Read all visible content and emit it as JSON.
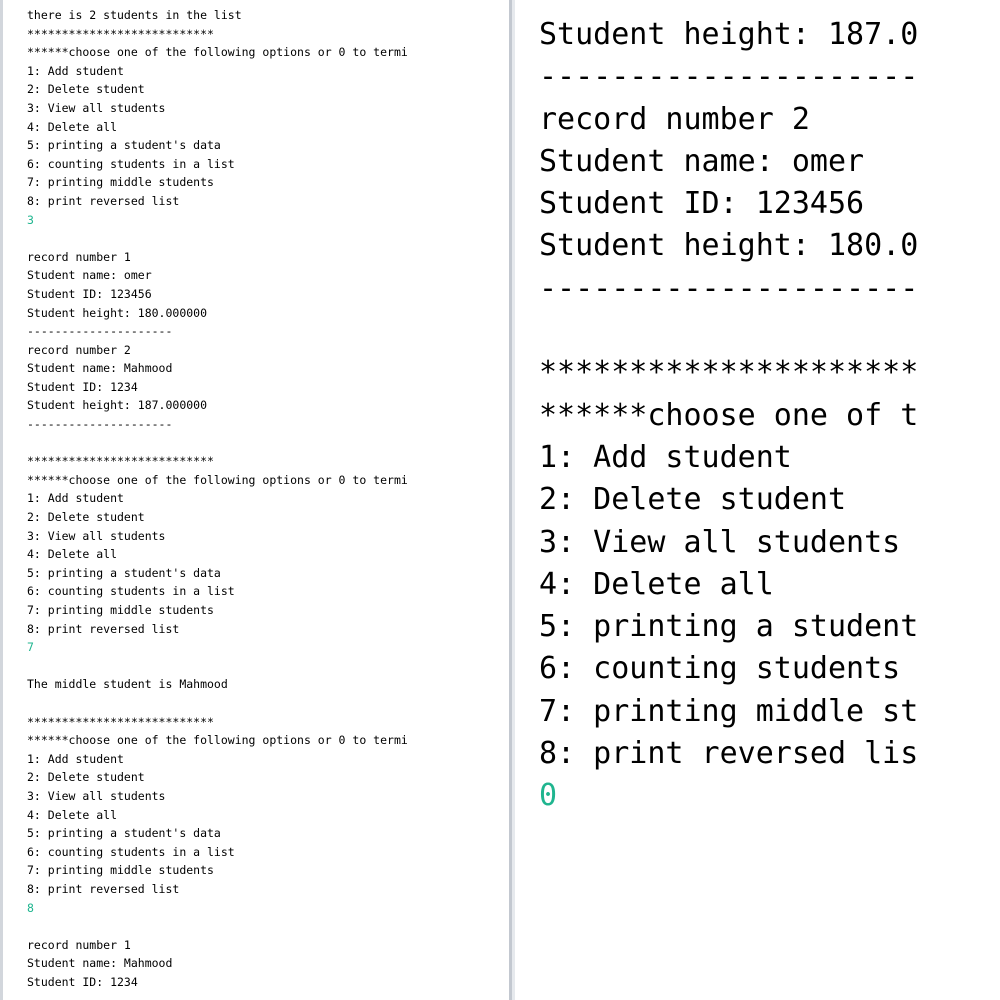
{
  "left_console": {
    "lines": [
      {
        "text": "there is 2 students in the list"
      },
      {
        "text": "***************************"
      },
      {
        "text": "******choose one of the following options or 0 to termi"
      },
      {
        "text": "1: Add student"
      },
      {
        "text": "2: Delete student"
      },
      {
        "text": "3: View all students"
      },
      {
        "text": "4: Delete all"
      },
      {
        "text": "5: printing a student's data"
      },
      {
        "text": "6: counting students in a list"
      },
      {
        "text": "7: printing middle students"
      },
      {
        "text": "8: print reversed list"
      },
      {
        "text": "3",
        "input": true
      },
      {
        "text": ""
      },
      {
        "text": "record number 1"
      },
      {
        "text": "Student name: omer"
      },
      {
        "text": "Student ID: 123456"
      },
      {
        "text": "Student height: 180.000000"
      },
      {
        "text": "---------------------"
      },
      {
        "text": "record number 2"
      },
      {
        "text": "Student name: Mahmood"
      },
      {
        "text": "Student ID: 1234"
      },
      {
        "text": "Student height: 187.000000"
      },
      {
        "text": "---------------------"
      },
      {
        "text": ""
      },
      {
        "text": "***************************"
      },
      {
        "text": "******choose one of the following options or 0 to termi"
      },
      {
        "text": "1: Add student"
      },
      {
        "text": "2: Delete student"
      },
      {
        "text": "3: View all students"
      },
      {
        "text": "4: Delete all"
      },
      {
        "text": "5: printing a student's data"
      },
      {
        "text": "6: counting students in a list"
      },
      {
        "text": "7: printing middle students"
      },
      {
        "text": "8: print reversed list"
      },
      {
        "text": "7",
        "input": true
      },
      {
        "text": ""
      },
      {
        "text": "The middle student is Mahmood"
      },
      {
        "text": ""
      },
      {
        "text": "***************************"
      },
      {
        "text": "******choose one of the following options or 0 to termi"
      },
      {
        "text": "1: Add student"
      },
      {
        "text": "2: Delete student"
      },
      {
        "text": "3: View all students"
      },
      {
        "text": "4: Delete all"
      },
      {
        "text": "5: printing a student's data"
      },
      {
        "text": "6: counting students in a list"
      },
      {
        "text": "7: printing middle students"
      },
      {
        "text": "8: print reversed list"
      },
      {
        "text": "8",
        "input": true
      },
      {
        "text": ""
      },
      {
        "text": "record number 1"
      },
      {
        "text": "Student name: Mahmood"
      },
      {
        "text": "Student ID: 1234"
      }
    ]
  },
  "right_console": {
    "lines": [
      {
        "text": "Student height: 187.0"
      },
      {
        "text": "---------------------"
      },
      {
        "text": "record number 2"
      },
      {
        "text": "Student name: omer"
      },
      {
        "text": "Student ID: 123456"
      },
      {
        "text": "Student height: 180.0"
      },
      {
        "text": "---------------------"
      },
      {
        "text": ""
      },
      {
        "text": "*********************"
      },
      {
        "text": "******choose one of t"
      },
      {
        "text": "1: Add student"
      },
      {
        "text": "2: Delete student"
      },
      {
        "text": "3: View all students"
      },
      {
        "text": "4: Delete all"
      },
      {
        "text": "5: printing a student"
      },
      {
        "text": "6: counting students"
      },
      {
        "text": "7: printing middle st"
      },
      {
        "text": "8: print reversed lis"
      },
      {
        "text": "0",
        "input": true
      }
    ]
  },
  "colors": {
    "input_text": "#1fb58f",
    "output_text": "#000000",
    "background": "#ffffff"
  }
}
